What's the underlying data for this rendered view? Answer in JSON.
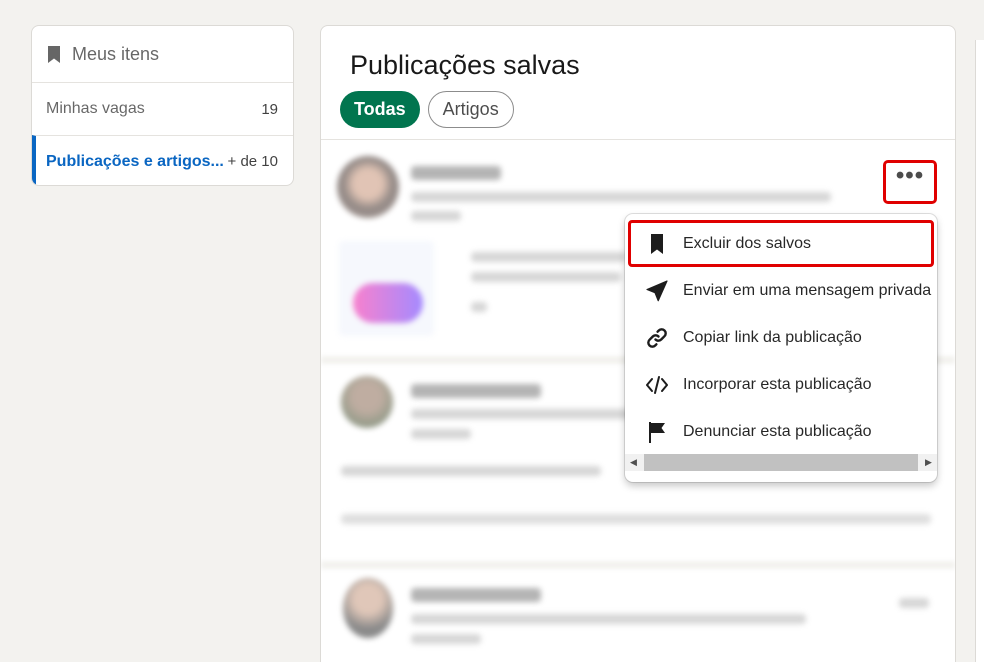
{
  "sidebar": {
    "title": "Meus itens",
    "items": [
      {
        "label": "Minhas vagas",
        "count": "19"
      },
      {
        "label": "Publicações e artigos...",
        "count": "+ de 10"
      }
    ]
  },
  "main": {
    "title": "Publicações salvas",
    "filters": [
      {
        "label": "Todas",
        "selected": true
      },
      {
        "label": "Artigos",
        "selected": false
      }
    ],
    "more_label": "•••"
  },
  "menu": {
    "items": [
      {
        "label": "Excluir dos salvos",
        "icon": "bookmark-icon"
      },
      {
        "label": "Enviar em uma mensagem privada",
        "icon": "send-icon"
      },
      {
        "label": "Copiar link da publicação",
        "icon": "link-icon"
      },
      {
        "label": "Incorporar esta publicação",
        "icon": "code-icon"
      },
      {
        "label": "Denunciar esta publicação",
        "icon": "flag-icon"
      }
    ]
  },
  "colors": {
    "accent_green": "#01754f",
    "accent_blue": "#0a66c2",
    "highlight_red": "#e00000"
  }
}
